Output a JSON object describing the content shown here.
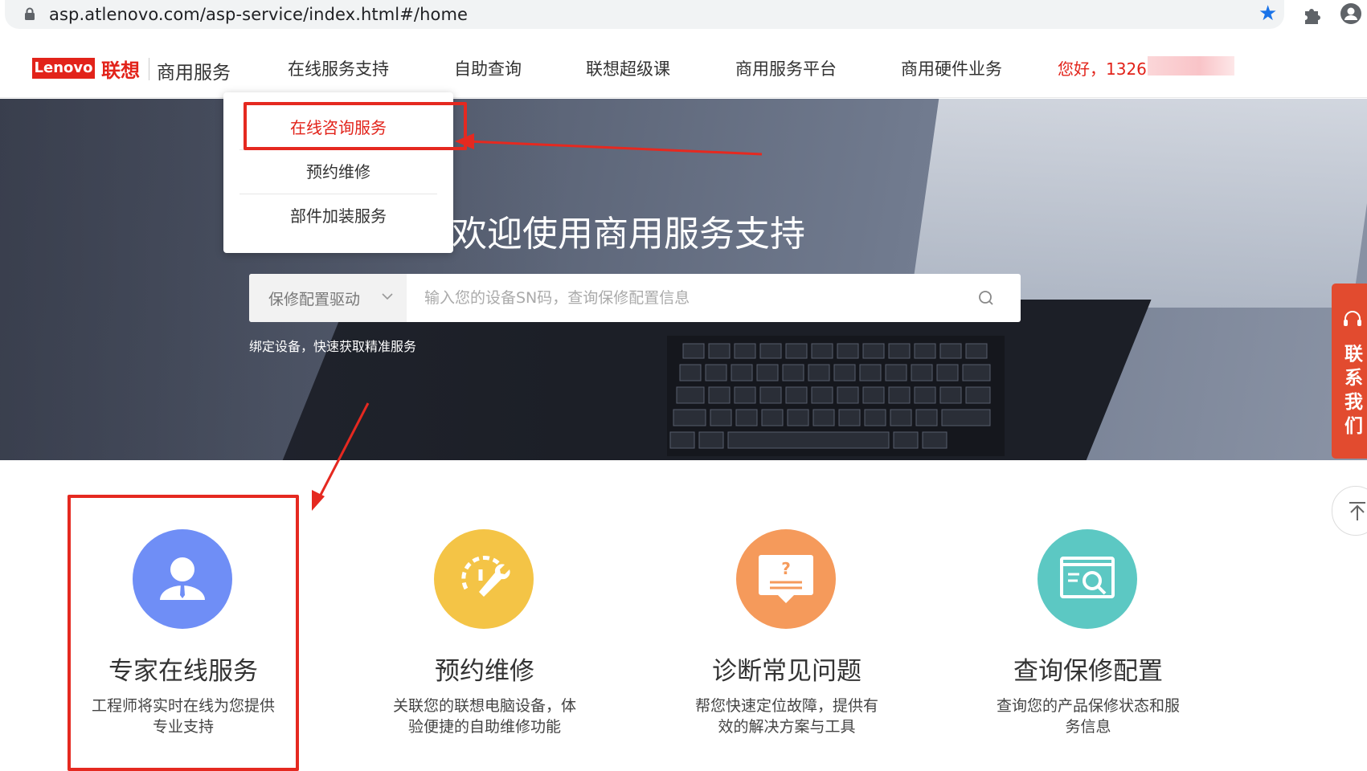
{
  "browser": {
    "url": "asp.atlenovo.com/asp-service/index.html#/home"
  },
  "header": {
    "logo_en": "Lenovo",
    "logo_cn": "联想",
    "logo_sub": "商用服务",
    "nav": [
      {
        "label": "在线服务支持"
      },
      {
        "label": "自助查询"
      },
      {
        "label": "联想超级课"
      },
      {
        "label": "商用服务平台"
      },
      {
        "label": "商用硬件业务"
      }
    ],
    "greeting": "您好，1326"
  },
  "dropdown": {
    "items": [
      {
        "label": "在线咨询服务"
      },
      {
        "label": "预约维修"
      },
      {
        "label": "部件加装服务"
      }
    ]
  },
  "hero": {
    "title": "欢迎使用商用服务支持",
    "search_select": "保修配置驱动",
    "search_placeholder": "输入您的设备SN码，查询保修配置信息",
    "bind_text": "绑定设备，快速获取精准服务"
  },
  "contact": {
    "chars": [
      "联",
      "系",
      "我",
      "们"
    ]
  },
  "cards": [
    {
      "title": "专家在线服务",
      "desc": "工程师将实时在线为您提供专业支持",
      "icon": "expert-icon",
      "color": "#6f8ef6"
    },
    {
      "title": "预约维修",
      "desc": "关联您的联想电脑设备，体验便捷的自助维修功能",
      "icon": "repair-icon",
      "color": "#f4c446"
    },
    {
      "title": "诊断常见问题",
      "desc": "帮您快速定位故障，提供有效的解决方案与工具",
      "icon": "faq-icon",
      "color": "#f59a5b"
    },
    {
      "title": "查询保修配置",
      "desc": "查询您的产品保修状态和服务信息",
      "icon": "warranty-search-icon",
      "color": "#5cc8c3"
    }
  ],
  "colors": {
    "brand_red": "#e2231a",
    "annotation_red": "#e52920"
  }
}
